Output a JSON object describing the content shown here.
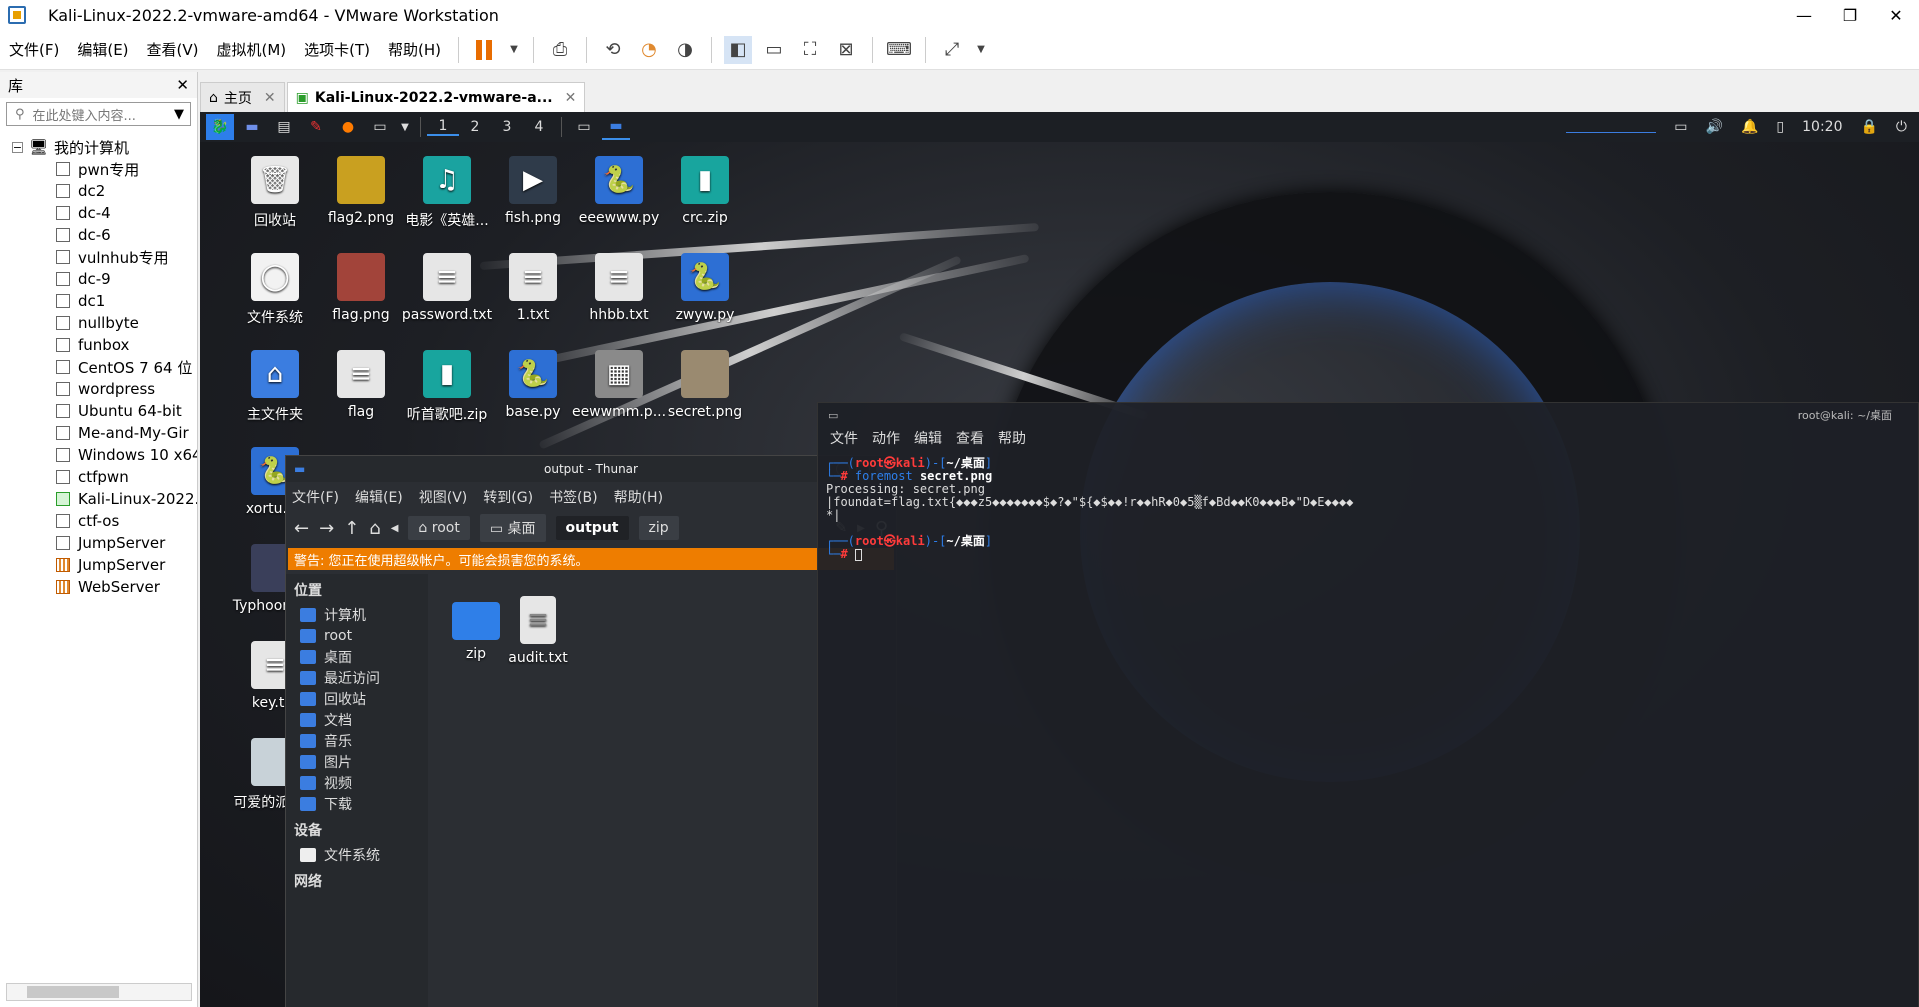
{
  "window": {
    "title": "Kali-Linux-2022.2-vmware-amd64 - VMware Workstation",
    "min": "—",
    "restore": "❐",
    "close": "✕"
  },
  "menu": [
    "文件(F)",
    "编辑(E)",
    "查看(V)",
    "虚拟机(M)",
    "选项卡(T)",
    "帮助(H)"
  ],
  "library": {
    "title": "库",
    "close": "✕",
    "search_placeholder": "在此处键入内容...",
    "root": "我的计算机",
    "vms": [
      {
        "name": "pwn专用",
        "kind": "normal"
      },
      {
        "name": "dc2",
        "kind": "normal"
      },
      {
        "name": "dc-4",
        "kind": "normal"
      },
      {
        "name": "dc-6",
        "kind": "normal"
      },
      {
        "name": "vulnhub专用",
        "kind": "normal"
      },
      {
        "name": "dc-9",
        "kind": "normal"
      },
      {
        "name": "dc1",
        "kind": "normal"
      },
      {
        "name": "nullbyte",
        "kind": "normal"
      },
      {
        "name": "funbox",
        "kind": "normal"
      },
      {
        "name": "CentOS 7 64 位",
        "kind": "normal"
      },
      {
        "name": "wordpress",
        "kind": "normal"
      },
      {
        "name": "Ubuntu 64-bit",
        "kind": "normal"
      },
      {
        "name": "Me-and-My-Gir",
        "kind": "normal"
      },
      {
        "name": "Windows 10 x64",
        "kind": "normal"
      },
      {
        "name": "ctfpwn",
        "kind": "normal"
      },
      {
        "name": "Kali-Linux-2022.",
        "kind": "running"
      },
      {
        "name": "ctf-os",
        "kind": "normal"
      },
      {
        "name": "JumpServer",
        "kind": "normal"
      },
      {
        "name": "JumpServer",
        "kind": "team"
      },
      {
        "name": "WebServer",
        "kind": "team"
      }
    ]
  },
  "tabs": [
    {
      "label": "主页",
      "close": "✕"
    },
    {
      "label": "Kali-Linux-2022.2-vmware-a...",
      "close": "✕"
    }
  ],
  "kali_panel": {
    "workspaces": [
      "1",
      "2",
      "3",
      "4"
    ],
    "time": "10:20"
  },
  "desktop_icons": [
    {
      "label": "回收站",
      "glyph": "🗑",
      "color": "#e8e8e8"
    },
    {
      "label": "flag2.png",
      "glyph": "",
      "color": "#c9a020"
    },
    {
      "label": "电影《英雄...",
      "glyph": "♫",
      "color": "#1aa3a0"
    },
    {
      "label": "fish.png",
      "glyph": "▶",
      "color": "#2f3b4a"
    },
    {
      "label": "eeewww.py",
      "glyph": "🐍",
      "color": "#2d6fd4"
    },
    {
      "label": "crc.zip",
      "glyph": "▮",
      "color": "#18a59e"
    },
    {
      "label": "文件系统",
      "glyph": "◯",
      "color": "#f2f2f2"
    },
    {
      "label": "flag.png",
      "glyph": "",
      "color": "#a2443a"
    },
    {
      "label": "password.txt",
      "glyph": "≡",
      "color": "#e6e6e6"
    },
    {
      "label": "1.txt",
      "glyph": "≡",
      "color": "#e6e6e6"
    },
    {
      "label": "hhbb.txt",
      "glyph": "≡",
      "color": "#e6e6e6"
    },
    {
      "label": "zwyw.py",
      "glyph": "🐍",
      "color": "#2d6fd4"
    },
    {
      "label": "主文件夹",
      "glyph": "⌂",
      "color": "#3b7de0"
    },
    {
      "label": "flag",
      "glyph": "≡",
      "color": "#e6e6e6"
    },
    {
      "label": "听首歌吧.zip",
      "glyph": "▮",
      "color": "#18a59e"
    },
    {
      "label": "base.py",
      "glyph": "🐍",
      "color": "#2d6fd4"
    },
    {
      "label": "eewwmm.p...",
      "glyph": "▦",
      "color": "#8a8a8a"
    },
    {
      "label": "secret.png",
      "glyph": "",
      "color": "#9a8a70"
    },
    {
      "label": "xortu.py",
      "glyph": "🐍",
      "color": "#2d6fd4"
    },
    {
      "label": "Typhoon.jpg",
      "glyph": "",
      "color": "#3a3f5a"
    },
    {
      "label": "key.txt",
      "glyph": "≡",
      "color": "#e6e6e6"
    },
    {
      "label": "可爱的派蒙...",
      "glyph": "",
      "color": "#c8d2d8"
    }
  ],
  "thunar": {
    "title": "output - Thunar",
    "menu": [
      "文件(F)",
      "编辑(E)",
      "视图(V)",
      "转到(G)",
      "书签(B)",
      "帮助(H)"
    ],
    "crumbs": [
      "root",
      "桌面",
      "output",
      "zip"
    ],
    "warning": "警告: 您正在使用超级帐户。可能会损害您的系统。",
    "sidebar_places_header": "位置",
    "places": [
      "计算机",
      "root",
      "桌面",
      "最近访问",
      "回收站",
      "文档",
      "音乐",
      "图片",
      "视频",
      "下载"
    ],
    "sidebar_devices_header": "设备",
    "devices": [
      "文件系统"
    ],
    "sidebar_network_header": "网络",
    "files": [
      {
        "name": "zip",
        "type": "folder"
      },
      {
        "name": "audit.txt",
        "type": "text"
      }
    ]
  },
  "terminal": {
    "title": "root@kali: ~/桌面",
    "menu": [
      "文件",
      "动作",
      "编辑",
      "查看",
      "帮助"
    ],
    "prompt_user": "root㉿kali",
    "prompt_dir": "~/桌面",
    "command_name": "foremost",
    "command_arg": "secret.png",
    "output_line1": "Processing: secret.png",
    "output_line2": "|foundat=flag.txt{◆◆◆z5◆◆◆◆◆◆◆$◆?◆\"${◆$◆◆!r◆◆hR◆0◆5▒f◆Bd◆◆K0◆◆◆B◆\"D◆E◆◆◆◆",
    "output_line3": "*|"
  }
}
